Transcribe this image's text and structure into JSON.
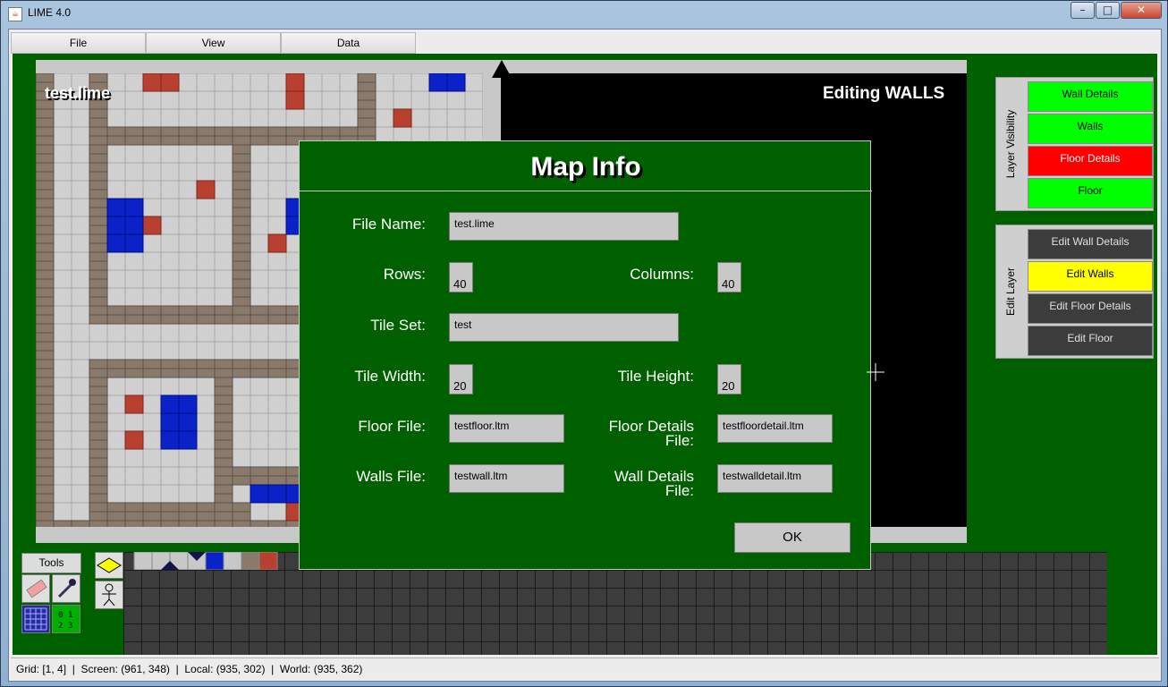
{
  "window": {
    "title": "LIME 4.0"
  },
  "menu": {
    "items": [
      "File",
      "View",
      "Data"
    ]
  },
  "map": {
    "filename": "test.lime",
    "editing_label": "Editing WALLS"
  },
  "layer_visibility": {
    "title": "Layer Visibility",
    "items": [
      {
        "label": "Wall Details",
        "state": "visible",
        "color": "#00ff00"
      },
      {
        "label": "Walls",
        "state": "visible",
        "color": "#00ff00"
      },
      {
        "label": "Floor Details",
        "state": "hidden",
        "color": "#ff0000"
      },
      {
        "label": "Floor",
        "state": "visible",
        "color": "#00ff00"
      }
    ]
  },
  "edit_layer": {
    "title": "Edit Layer",
    "items": [
      {
        "label": "Edit Wall Details",
        "selected": false
      },
      {
        "label": "Edit Walls",
        "selected": true
      },
      {
        "label": "Edit Floor Details",
        "selected": false
      },
      {
        "label": "Edit Floor",
        "selected": false
      }
    ]
  },
  "dialog": {
    "title": "Map Info",
    "file_name_label": "File Name:",
    "file_name": "test.lime",
    "rows_label": "Rows:",
    "rows": "40",
    "columns_label": "Columns:",
    "columns": "40",
    "tile_set_label": "Tile Set:",
    "tile_set": "test",
    "tile_width_label": "Tile Width:",
    "tile_width": "20",
    "tile_height_label": "Tile Height:",
    "tile_height": "20",
    "floor_file_label": "Floor File:",
    "floor_file": "testfloor.ltm",
    "floor_details_label_1": "Floor Details",
    "floor_details_label_2": "File:",
    "floor_details_file": "testfloordetail.ltm",
    "walls_file_label": "Walls File:",
    "walls_file": "testwall.ltm",
    "wall_details_label_1": "Wall Details",
    "wall_details_label_2": "File:",
    "wall_details_file": "testwalldetail.ltm",
    "ok_label": "OK"
  },
  "tools": {
    "label": "Tools",
    "items": [
      "eraser-icon",
      "eyedropper-icon",
      "grid-icon",
      "numbered-grid-icon"
    ],
    "numbered_grid_text": [
      "0",
      "1",
      "2",
      "3"
    ]
  },
  "status": {
    "grid": "Grid:  [1, 4]",
    "screen": "Screen:  (961, 348)",
    "local": "Local:  (935, 302)",
    "world": "World:  (935, 362)",
    "separator": "|"
  },
  "colors": {
    "background_green": "#006000",
    "visible_layer": "#00ff00",
    "hidden_layer": "#ff0000",
    "selected_edit_layer": "#ffff00",
    "unselected_edit_layer": "#3c3c3c"
  }
}
